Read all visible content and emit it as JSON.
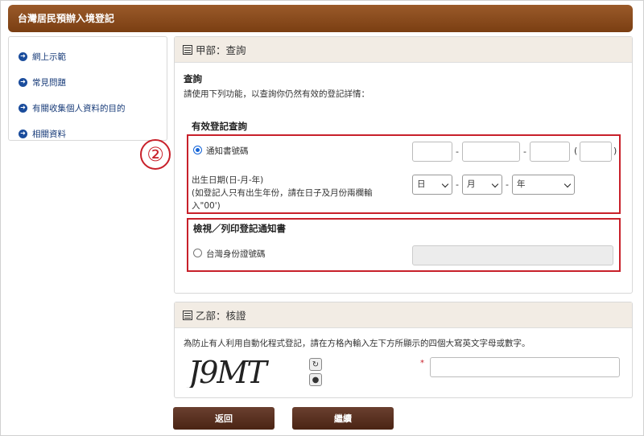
{
  "header": {
    "title": "台灣居民預辦入境登記"
  },
  "sidebar": {
    "items": [
      {
        "label": "網上示範"
      },
      {
        "label": "常見問題"
      },
      {
        "label": "有關收集個人資料的目的"
      },
      {
        "label": "相關資料"
      }
    ]
  },
  "part_a": {
    "heading": "甲部：查詢",
    "title": "查詢",
    "description": "請使用下列功能，以查詢你仍然有效的登記詳情：",
    "valid_query": {
      "title": "有效登記查詢",
      "callout_number": "②",
      "notice_radio_label": "通知書號碼",
      "notice_radio_selected": true,
      "dob_label_line1": "出生日期(日-月-年)",
      "dob_label_line2": "(如登記人只有出生年份，請在日子及月份兩欄輸",
      "dob_label_line3": "入\"00')",
      "day_select": "日",
      "month_select": "月",
      "year_select": "年",
      "dash": "-",
      "paren_open": "(",
      "paren_close": ")"
    },
    "print_notice": {
      "title": "檢視／列印登記通知書",
      "id_radio_label": "台灣身份證號碼",
      "id_radio_selected": false
    }
  },
  "part_b": {
    "heading": "乙部：核證",
    "instruction": "為防止有人利用自動化程式登記，請在方格內輸入左下方所顯示的四個大寫英文字母或數字。",
    "captcha_text": "J9MT",
    "required_mark": "*"
  },
  "buttons": {
    "back": "返回",
    "continue": "繼續"
  }
}
